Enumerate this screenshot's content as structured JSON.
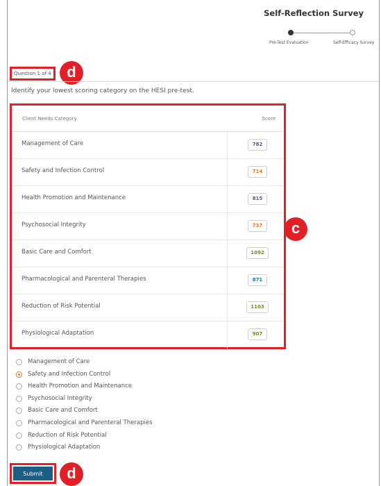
{
  "header": {
    "title": "Self-Reflection Survey",
    "steps": [
      {
        "label": "Pre-Test Evaluation",
        "state": "active"
      },
      {
        "label": "Self-Efficacy Survey",
        "state": "inactive"
      }
    ]
  },
  "question": {
    "counter": "Question 1 of 4",
    "prompt": "Identify your lowest scoring category on the HESI pre-test."
  },
  "annotations": {
    "d_top": "d",
    "c_table": "c",
    "d_bottom": "d",
    "color": "#e01f26"
  },
  "table": {
    "col_category": "Client Needs Category",
    "col_score": "Score",
    "rows": [
      {
        "category": "Management of Care",
        "score": "782",
        "color": "#5a4fa0"
      },
      {
        "category": "Safety and Infection Control",
        "score": "714",
        "color": "#e07a2a"
      },
      {
        "category": "Health Promotion and Maintenance",
        "score": "815",
        "color": "#5a4fa0"
      },
      {
        "category": "Psychosocial Integrity",
        "score": "737",
        "color": "#e07a2a"
      },
      {
        "category": "Basic Care and Comfort",
        "score": "1092",
        "color": "#7a8a1a"
      },
      {
        "category": "Pharmacological and Parenteral Therapies",
        "score": "871",
        "color": "#1e7a9a"
      },
      {
        "category": "Reduction of Risk Potential",
        "score": "1103",
        "color": "#7a8a1a"
      },
      {
        "category": "Physiological Adaptation",
        "score": "907",
        "color": "#7a8a1a"
      }
    ]
  },
  "options": {
    "selected_index": 1,
    "items": [
      "Management of Care",
      "Safety and Infection Control",
      "Health Promotion and Maintenance",
      "Psychosocial Integrity",
      "Basic Care and Comfort",
      "Pharmacological and Parenteral Therapies",
      "Reduction of Risk Potential",
      "Physiological Adaptation"
    ]
  },
  "submit": {
    "label": "Submit",
    "color": "#1b5f85"
  }
}
